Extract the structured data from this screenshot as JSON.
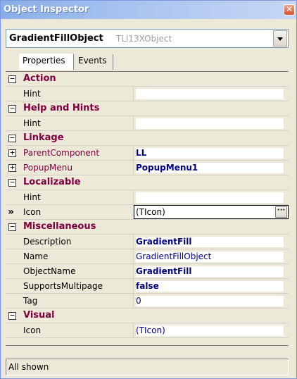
{
  "window": {
    "title": "Object Inspector",
    "close_glyph": "✕"
  },
  "object_selector": {
    "name": "GradientFillObject",
    "class_name": "TLl13XObject"
  },
  "tabs": [
    {
      "label": "Properties",
      "active": true
    },
    {
      "label": "Events",
      "active": false
    }
  ],
  "rows": [
    {
      "kind": "category",
      "label": "Action",
      "expander": "−"
    },
    {
      "kind": "property",
      "name": "Hint",
      "value": "",
      "style": "plain"
    },
    {
      "kind": "category",
      "label": "Help and Hints",
      "expander": "−"
    },
    {
      "kind": "property",
      "name": "Hint",
      "value": "",
      "style": "plain"
    },
    {
      "kind": "category",
      "label": "Linkage",
      "expander": "−"
    },
    {
      "kind": "property",
      "name": "ParentComponent",
      "value": "LL",
      "style": "bold",
      "expander": "+",
      "link": true
    },
    {
      "kind": "property",
      "name": "PopupMenu",
      "value": "PopupMenu1",
      "style": "bold",
      "expander": "+",
      "link": true
    },
    {
      "kind": "category",
      "label": "Localizable",
      "expander": "−"
    },
    {
      "kind": "property",
      "name": "Hint",
      "value": "",
      "style": "plain"
    },
    {
      "kind": "property",
      "name": "Icon",
      "value": "(TIcon)",
      "style": "plain",
      "selected": true,
      "marker": "»",
      "button": "···"
    },
    {
      "kind": "category",
      "label": "Miscellaneous",
      "expander": "−"
    },
    {
      "kind": "property",
      "name": "Description",
      "value": "GradientFill",
      "style": "bold"
    },
    {
      "kind": "property",
      "name": "Name",
      "value": "GradientFillObject",
      "style": "blue"
    },
    {
      "kind": "property",
      "name": "ObjectName",
      "value": "GradientFill",
      "style": "bold"
    },
    {
      "kind": "property",
      "name": "SupportsMultipage",
      "value": "false",
      "style": "bold"
    },
    {
      "kind": "property",
      "name": "Tag",
      "value": "0",
      "style": "blue"
    },
    {
      "kind": "category",
      "label": "Visual",
      "expander": "−"
    },
    {
      "kind": "property",
      "name": "Icon",
      "value": "(TIcon)",
      "style": "blue"
    }
  ],
  "status_bar": {
    "text": "All shown"
  },
  "colors": {
    "category": "#800040",
    "value_highlight": "#000080"
  }
}
